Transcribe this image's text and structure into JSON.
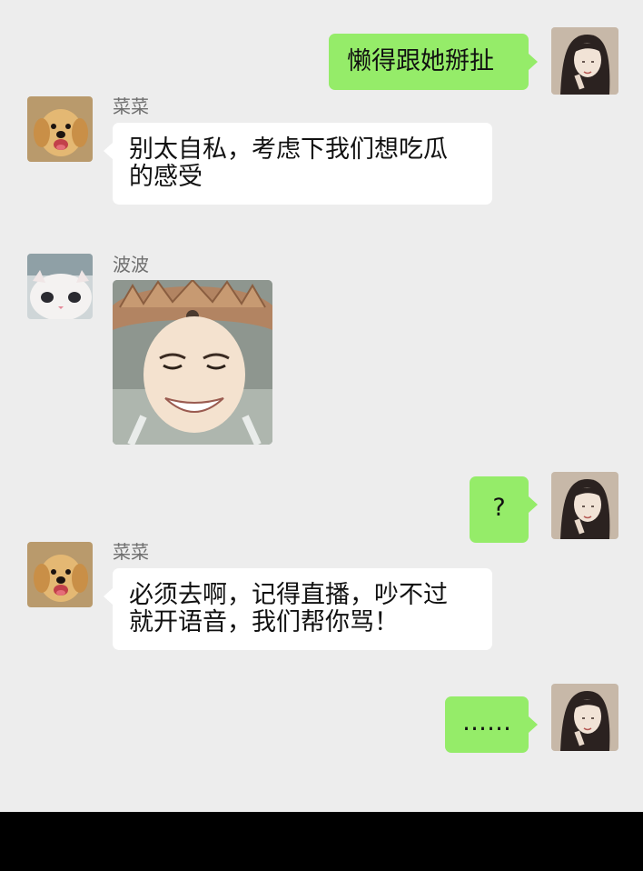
{
  "messages": [
    {
      "side": "out",
      "sender": "",
      "text": "懒得跟她掰扯"
    },
    {
      "side": "in",
      "sender": "菜菜",
      "text": "别太自私，考虑下我们想吃瓜\n的感受"
    },
    {
      "side": "in",
      "sender": "波波",
      "text": "",
      "sticker": "grinning-deity-statue-sticker"
    },
    {
      "side": "out",
      "sender": "",
      "text": "?"
    },
    {
      "side": "in",
      "sender": "菜菜",
      "text": "必须去啊，记得直播，吵不过\n就开语音，我们帮你骂！"
    },
    {
      "side": "out",
      "sender": "",
      "text": "……"
    }
  ],
  "colors": {
    "background": "#ededed",
    "outgoing_bubble": "#95ec69",
    "incoming_bubble": "#ffffff",
    "bottom_bar": "#000000"
  }
}
